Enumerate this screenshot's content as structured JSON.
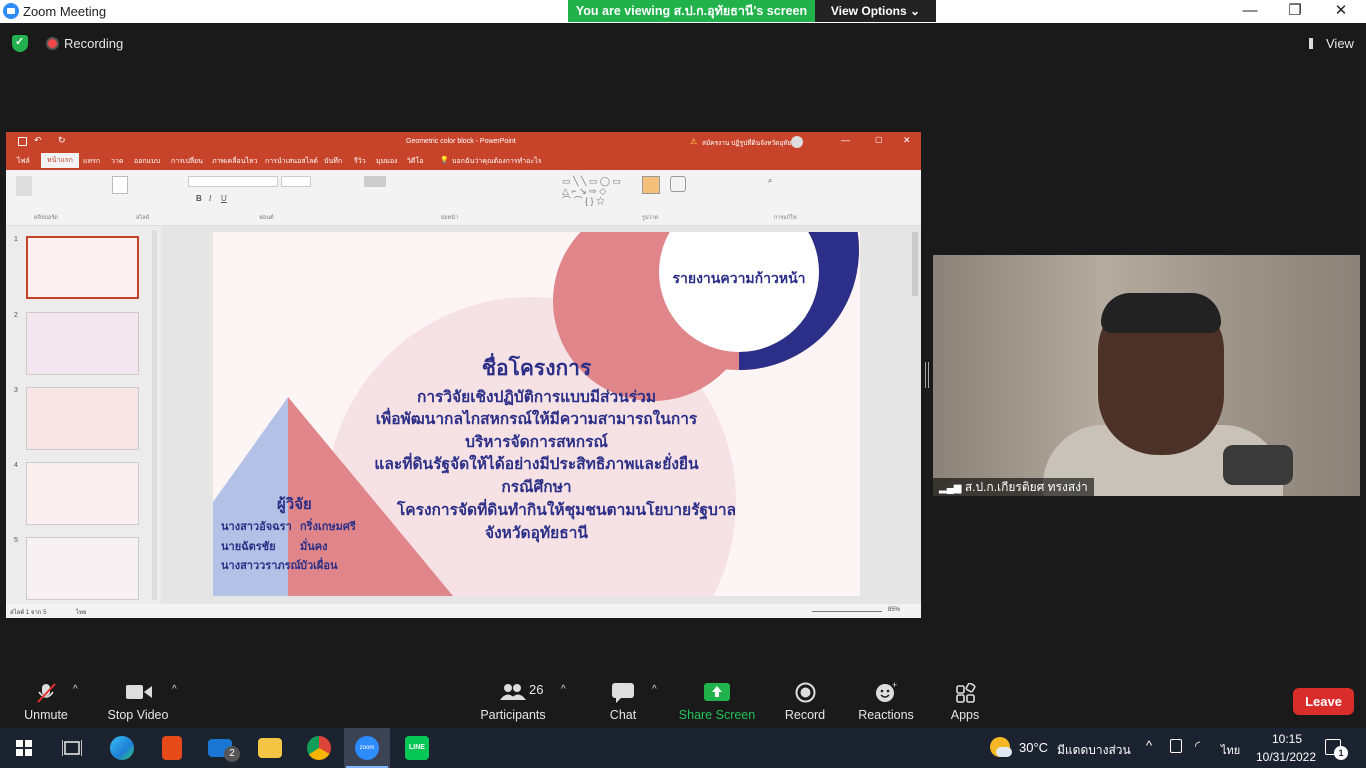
{
  "window": {
    "title": "Zoom Meeting"
  },
  "banner": {
    "text": "You are viewing ส.ป.ก.อุทัยธานี's screen",
    "view_options": "View Options"
  },
  "meeting": {
    "recording_label": "Recording",
    "view_label": "View"
  },
  "powerpoint": {
    "doc_title": "Geometric color block  -  PowerPoint",
    "user": "สมัครงาน ปฏิรูปที่ดินจังหวัดอุทัย",
    "tabs": [
      "ไฟล์",
      "หน้าแรก",
      "แทรก",
      "วาด",
      "ออกแบบ",
      "การเปลี่ยน",
      "ภาพเคลื่อนไหว",
      "การนำเสนอสไลด์",
      "บันทึก",
      "รีวิว",
      "มุมมอง",
      "วิดีโอ",
      "บอกฉันว่าคุณต้องการทำอะไร"
    ],
    "ribbon_groups": [
      "คลิปบอร์ด",
      "สไลด์",
      "ฟอนต์",
      "ย่อหน้า",
      "รูปวาด",
      "การแก้ไข"
    ],
    "status_left": "สไลด์ 1 จาก 5",
    "status_lang": "ไทย",
    "zoom_pct": "85%",
    "thumb_numbers": [
      "1",
      "2",
      "3",
      "4",
      "5"
    ]
  },
  "slide": {
    "badge": "รายงานความก้าวหน้า",
    "heading": "ชื่อโครงการ",
    "lines": [
      "การวิจัยเชิงปฏิบัติการแบบมีส่วนร่วม",
      "เพื่อพัฒนากลไกสหกรณ์ให้มีความสามารถในการ",
      "บริหารจัดการสหกรณ์",
      "และที่ดินรัฐจัดให้ได้อย่างมีประสิทธิภาพและยั่งยืน",
      "กรณีศึกษา",
      "โครงการจัดที่ดินทำกินให้ชุมชนตามนโยบายรัฐบาล",
      "จังหวัดอุทัยธานี"
    ],
    "researchers_title": "ผู้วิจัย",
    "researchers": [
      {
        "first": "นางสาวอัจฉรา",
        "last": "กริ่งเกษมศรี"
      },
      {
        "first": "นายฉัตรชัย",
        "last": "มั่นคง"
      },
      {
        "first": "นางสาววราภรณ์",
        "last": "บัวเผื่อน"
      }
    ]
  },
  "participant": {
    "name": "ส.ป.ก.เกียรติยศ ทรงสง่า"
  },
  "toolbar": {
    "unmute": "Unmute",
    "stop_video": "Stop Video",
    "participants": "Participants",
    "participant_count": "26",
    "chat": "Chat",
    "share_screen": "Share Screen",
    "record": "Record",
    "reactions": "Reactions",
    "apps": "Apps",
    "leave": "Leave"
  },
  "taskbar": {
    "temperature": "30°C",
    "weather": "มีแดดบางส่วน",
    "lang": "ไทย",
    "time": "10:15",
    "date": "10/31/2022",
    "mail_badge": "2",
    "notif_badge": "1"
  },
  "colors": {
    "zoom_green": "#21b24b",
    "ppt_red": "#c7432a",
    "leave_red": "#d92d2b",
    "slide_navy": "#2b2f87",
    "slide_pink": "#e0868b"
  }
}
